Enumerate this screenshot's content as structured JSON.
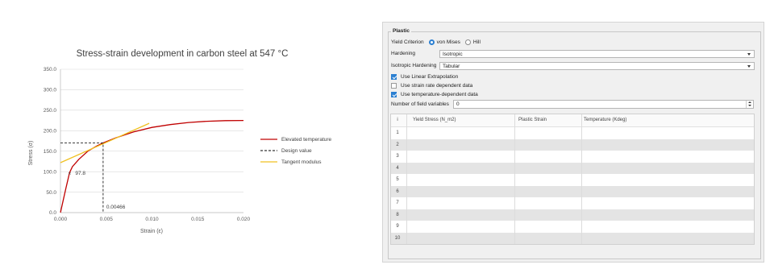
{
  "chart_data": {
    "type": "line",
    "title": "Stress-strain development in carbon steel at 547 °C",
    "xlabel": "Strain (ε)",
    "ylabel": "Stress (σ)",
    "xlim": [
      0,
      0.02
    ],
    "ylim": [
      0,
      350
    ],
    "xticks": [
      "0.000",
      "0.005",
      "0.010",
      "0.015",
      "0.020"
    ],
    "xtick_values": [
      0,
      0.005,
      0.01,
      0.015,
      0.02
    ],
    "yticks": [
      "0.0",
      "50.0",
      "100.0",
      "150.0",
      "200.0",
      "250.0",
      "300.0",
      "350.0"
    ],
    "ytick_values": [
      0,
      50,
      100,
      150,
      200,
      250,
      300,
      350
    ],
    "grid": "horizontal",
    "legend_position": "right",
    "series": [
      {
        "name": "Elevated temperature",
        "style": "solid",
        "color": "#c00000",
        "x": [
          0,
          0.0003,
          0.0006,
          0.001,
          0.0013,
          0.002,
          0.003,
          0.004,
          0.00466,
          0.006,
          0.008,
          0.01,
          0.012,
          0.014,
          0.016,
          0.018,
          0.02
        ],
        "y": [
          0,
          30,
          60,
          97.8,
          112,
          130,
          150,
          163,
          170,
          182,
          197,
          208,
          215,
          220,
          223,
          224.5,
          225
        ]
      },
      {
        "name": "Design value",
        "style": "dashed",
        "color": "#000000",
        "x": [
          0,
          0.00466,
          0.00466
        ],
        "y": [
          170,
          170,
          0
        ]
      },
      {
        "name": "Tangent modulus",
        "style": "solid",
        "color": "#f0c020",
        "x": [
          0,
          0.0097
        ],
        "y": [
          122,
          218
        ]
      }
    ],
    "annotations": [
      {
        "text": "97.8",
        "x": 0.001,
        "y": 97.8,
        "marker": "×"
      },
      {
        "text": "0.00466",
        "x": 0.00466,
        "y": 15
      }
    ]
  },
  "panel": {
    "group_title": "Plastic",
    "yield_criterion_label": "Yield Criterion",
    "yield_options": [
      {
        "label": "von Mises",
        "selected": true
      },
      {
        "label": "Hill",
        "selected": false
      }
    ],
    "hardening_label": "Hardening",
    "hardening_value": "Isotropic",
    "iso_hardening_label": "Isotropic Hardening",
    "iso_hardening_value": "Tabular",
    "checkboxes": [
      {
        "label": "Use Linear Extrapolation",
        "checked": true
      },
      {
        "label": "Use strain rate dependent data",
        "checked": false
      },
      {
        "label": "Use temperature-dependent data",
        "checked": true
      }
    ],
    "field_vars_label": "Number of field variables",
    "field_vars_value": "0",
    "table": {
      "corner": "i",
      "columns": [
        "Yield Stress (N_m2)",
        "Plastic Strain",
        "Temperature (Kdeg)"
      ],
      "rows": [
        "1",
        "2",
        "3",
        "4",
        "5",
        "6",
        "7",
        "8",
        "9",
        "10"
      ]
    }
  },
  "colors": {
    "accent": "#2b7fd1",
    "curve": "#c00000",
    "tangent": "#f0c020"
  }
}
